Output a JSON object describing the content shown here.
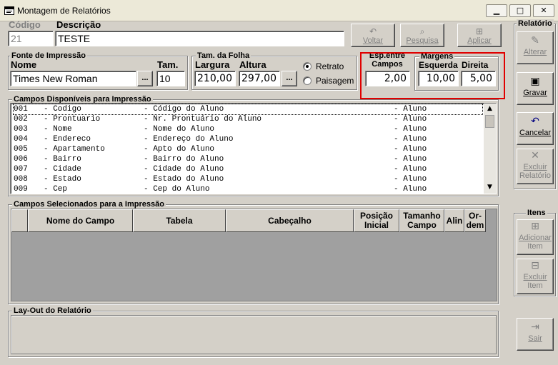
{
  "window": {
    "title": "Montagem de Relatórios",
    "minimize": "▁",
    "maximize": "□",
    "close": "✕"
  },
  "header": {
    "codigo_label": "Código",
    "codigo_value": "21",
    "descricao_label": "Descrição",
    "descricao_value": "TESTE"
  },
  "toolbar": {
    "voltar": "Voltar",
    "pesquisa": "Pesquisa",
    "aplicar": "Aplicar"
  },
  "fonte": {
    "group_label": "Fonte de Impressão",
    "nome_label": "Nome",
    "nome_value": "Times New Roman",
    "browse": "...",
    "tam_label": "Tam.",
    "tam_value": "10"
  },
  "folha": {
    "group_label": "Tam. da Folha",
    "largura_label": "Largura",
    "largura_value": "210,00",
    "altura_label": "Altura",
    "altura_value": "297,00",
    "browse": "...",
    "retrato": "Retrato",
    "paisagem": "Paisagem"
  },
  "esp": {
    "label_line1": "Esp.entre",
    "label_line2": "Campos",
    "value": "2,00"
  },
  "margens": {
    "group_label": "Margens",
    "esquerda_label": "Esquerda",
    "esquerda_value": "10,00",
    "direita_label": "Direita",
    "direita_value": "5,00"
  },
  "campos_disponiveis": {
    "group_label": "Campos Disponíveis para Impressão",
    "rows": [
      {
        "code": "001",
        "name": "Codigo",
        "desc": "Código do Aluno",
        "table": "Aluno"
      },
      {
        "code": "002",
        "name": "Prontuario",
        "desc": "Nr. Prontuário do Aluno",
        "table": "Aluno"
      },
      {
        "code": "003",
        "name": "Nome",
        "desc": "Nome do Aluno",
        "table": "Aluno"
      },
      {
        "code": "004",
        "name": "Endereco",
        "desc": "Endereço do Aluno",
        "table": "Aluno"
      },
      {
        "code": "005",
        "name": "Apartamento",
        "desc": "Apto do Aluno",
        "table": "Aluno"
      },
      {
        "code": "006",
        "name": "Bairro",
        "desc": "Bairro do Aluno",
        "table": "Aluno"
      },
      {
        "code": "007",
        "name": "Cidade",
        "desc": "Cidade do Aluno",
        "table": "Aluno"
      },
      {
        "code": "008",
        "name": "Estado",
        "desc": "Estado do Aluno",
        "table": "Aluno"
      },
      {
        "code": "009",
        "name": "Cep",
        "desc": "Cep do Aluno",
        "table": "Aluno"
      }
    ]
  },
  "campos_selecionados": {
    "group_label": "Campos Selecionados para a Impressão",
    "columns": {
      "nome_do_campo": "Nome do Campo",
      "tabela": "Tabela",
      "cabecalho": "Cabeçalho",
      "posicao_1": "Posição",
      "posicao_2": "Inicial",
      "tamanho_1": "Tamanho",
      "tamanho_2": "Campo",
      "alin": "Alin",
      "ordem_1": "Or-",
      "ordem_2": "dem"
    }
  },
  "layout_section": {
    "group_label": "Lay-Out do Relatório"
  },
  "relatorio_panel": {
    "group_label": "Relatório",
    "alterar": "Alterar",
    "gravar": "Gravar",
    "cancelar": "Cancelar",
    "excluir_1": "Excluir",
    "excluir_2": "Relatório"
  },
  "itens_panel": {
    "group_label": "Itens",
    "adicionar_1": "Adicionar",
    "adicionar_2": "Item",
    "excluir_1": "Excluir",
    "excluir_2": "Item"
  },
  "sair": "Sair",
  "icons": {
    "app": "report-window-icon",
    "voltar": "back-icon",
    "pesquisa": "search-icon",
    "aplicar": "apply-icon",
    "alterar": "edit-icon",
    "gravar": "floppy-disk-icon",
    "cancelar": "undo-icon",
    "excluir": "delete-x-icon",
    "adicionar": "add-item-icon",
    "excluir_item": "remove-item-icon",
    "sair": "exit-door-icon"
  },
  "colors": {
    "face": "#d4d0c8",
    "highlight_box": "#e00000",
    "grid_bg": "#a0a0a0",
    "disabled_text": "#808080"
  }
}
